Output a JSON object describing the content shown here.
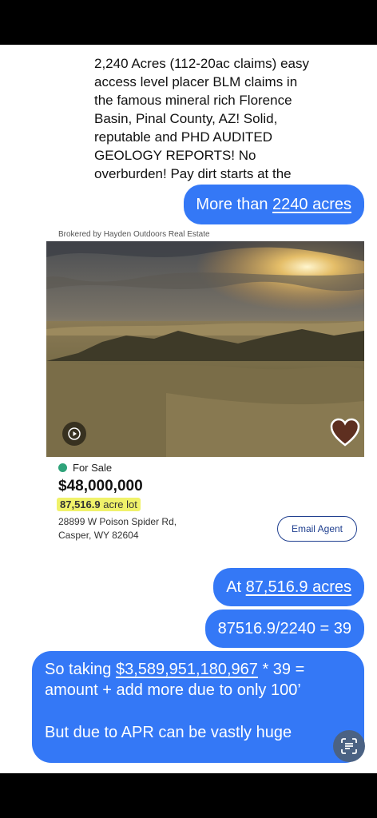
{
  "incoming_message": {
    "lines": [
      "2,240 Acres (112-20ac claims) easy",
      "access level placer BLM claims in",
      "the famous mineral rich Florence",
      "Basin, Pinal County, AZ! Solid,",
      "reputable and PHD AUDITED",
      "GEOLOGY REPORTS! No",
      "overburden! Pay dirt starts at the"
    ]
  },
  "bubble1": {
    "prefix": "More than ",
    "link": "2240 acres"
  },
  "listing": {
    "broker": "Brokered by Hayden Outdoors Real Estate",
    "status": "For Sale",
    "price": "$48,000,000",
    "lot_size": "87,516.9",
    "lot_unit": " acre lot",
    "address_line1": "28899 W Poison Spider Rd,",
    "address_line2": "Casper, WY 82604",
    "email_button": "Email Agent"
  },
  "bubble2": {
    "prefix": "At ",
    "link": "87,516.9 acres"
  },
  "bubble3": {
    "text": "87516.9/2240 = 39"
  },
  "bubble4": {
    "line1_prefix": "So taking ",
    "line1_link": "$3,589,951,180,967",
    "line1_suffix": " * 39 =",
    "line2": "amount + add more due to only 100’",
    "line3": "But due to APR can be vastly huge"
  },
  "colors": {
    "bubble": "#3478f6",
    "status_dot": "#2fa37a",
    "highlight": "#f0f26a"
  },
  "icons": [
    "play-icon",
    "heart-icon",
    "live-text-scan-icon"
  ]
}
